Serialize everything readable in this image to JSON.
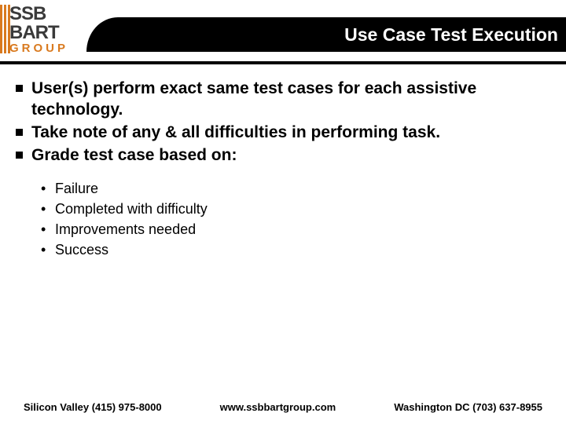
{
  "header": {
    "logo": {
      "line1": "SSB",
      "line2": "BART",
      "line3": "GROUP"
    },
    "title": "Use Case Test Execution"
  },
  "bullets": [
    "User(s) perform exact same test cases for each assistive technology.",
    "Take note of any & all difficulties in performing task.",
    "Grade test case based on:"
  ],
  "sub_bullets": [
    "Failure",
    "Completed with difficulty",
    "Improvements needed",
    "Success"
  ],
  "footer": {
    "left": "Silicon Valley (415) 975-8000",
    "center": "www.ssbbartgroup.com",
    "right": "Washington DC  (703) 637-8955"
  }
}
